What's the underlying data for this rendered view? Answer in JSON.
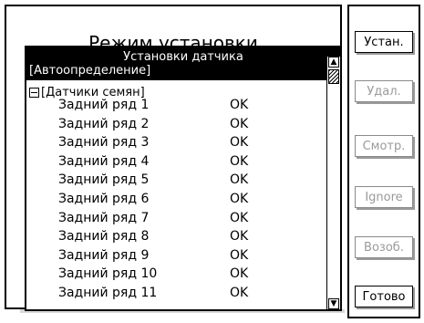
{
  "background": {
    "title": "Режим установки"
  },
  "dialog": {
    "title": "Установки датчика",
    "subtitle": "[Автоопределение]",
    "group": {
      "label": "[Датчики семян]"
    },
    "rows": [
      {
        "name": "Задний ряд 1",
        "status": "OK"
      },
      {
        "name": "Задний ряд 2",
        "status": "OK"
      },
      {
        "name": "Задний ряд 3",
        "status": "OK"
      },
      {
        "name": "Задний ряд 4",
        "status": "OK"
      },
      {
        "name": "Задний ряд 5",
        "status": "OK"
      },
      {
        "name": "Задний ряд 6",
        "status": "OK"
      },
      {
        "name": "Задний ряд 7",
        "status": "OK"
      },
      {
        "name": "Задний ряд 8",
        "status": "OK"
      },
      {
        "name": "Задний ряд 9",
        "status": "OK"
      },
      {
        "name": "Задний ряд 10",
        "status": "OK"
      },
      {
        "name": "Задний ряд 11",
        "status": "OK"
      }
    ]
  },
  "buttons": {
    "install": "Устан.",
    "delete": "Удал.",
    "view": "Смотр.",
    "ignore": "Ignore",
    "resume": "Возоб.",
    "done": "Готово"
  },
  "scrollbar": {
    "up_icon": "arrow-up-icon",
    "down_icon": "arrow-down-icon"
  },
  "colors": {
    "disabled": "#9a9a9a",
    "header_bg": "#000000",
    "header_fg": "#ffffff"
  }
}
